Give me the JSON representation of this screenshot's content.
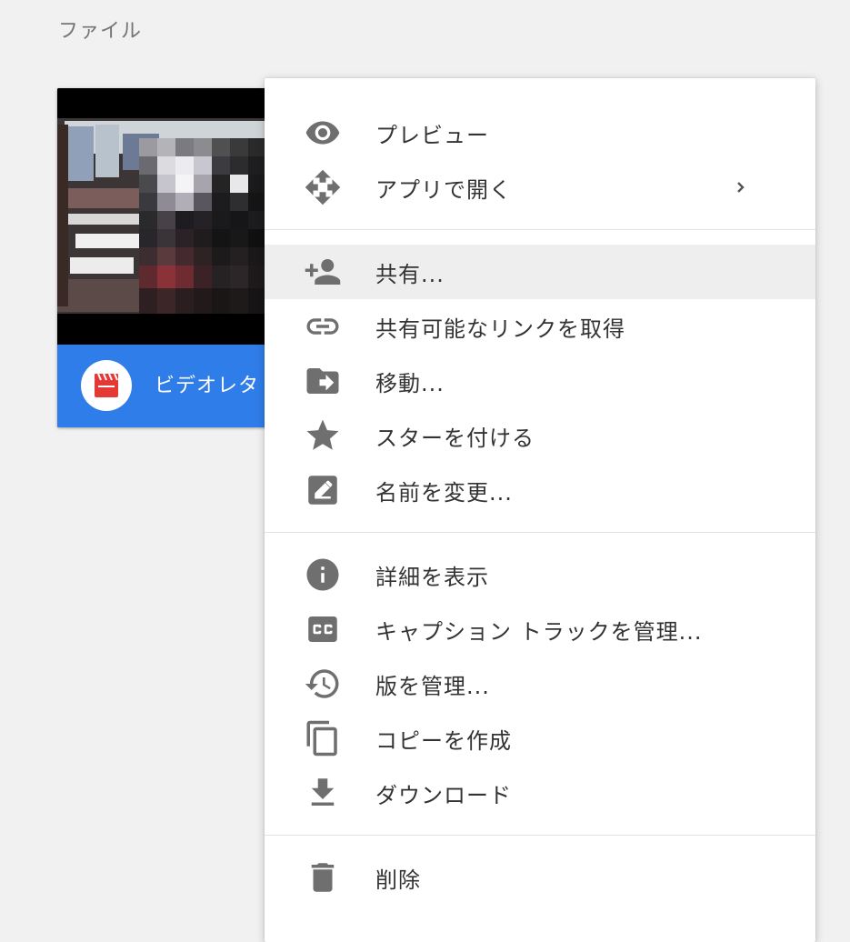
{
  "page": {
    "section_title": "ファイル"
  },
  "file_card": {
    "name": "ビデオレタ",
    "type_icon": "video-clapperboard-icon",
    "accent_color": "#2f7de9",
    "badge_color": "#e53935"
  },
  "menu": {
    "groups": [
      {
        "items": [
          {
            "label": "プレビュー",
            "icon": "eye-icon"
          },
          {
            "label": "アプリで開く",
            "icon": "move-arrows-icon",
            "has_submenu": true
          }
        ]
      },
      {
        "items": [
          {
            "label": "共有...",
            "icon": "person-add-icon",
            "highlighted": true
          },
          {
            "label": "共有可能なリンクを取得",
            "icon": "link-icon"
          },
          {
            "label": "移動...",
            "icon": "folder-move-icon"
          },
          {
            "label": "スターを付ける",
            "icon": "star-icon"
          },
          {
            "label": "名前を変更...",
            "icon": "edit-pencil-icon"
          }
        ]
      },
      {
        "items": [
          {
            "label": "詳細を表示",
            "icon": "info-icon"
          },
          {
            "label": "キャプション トラックを管理...",
            "icon": "closed-caption-icon"
          },
          {
            "label": "版を管理...",
            "icon": "history-icon"
          },
          {
            "label": "コピーを作成",
            "icon": "copy-icon"
          },
          {
            "label": "ダウンロード",
            "icon": "download-icon"
          }
        ]
      },
      {
        "items": [
          {
            "label": "削除",
            "icon": "trash-icon"
          }
        ]
      }
    ],
    "icon_color": "#6f6f6f",
    "highlight_color": "#eeeeee"
  }
}
